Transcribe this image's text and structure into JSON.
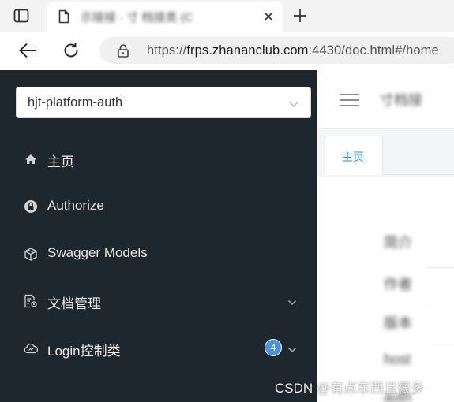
{
  "browser": {
    "tab_title": "示接接 · 寸 档接类 (C",
    "address": {
      "scheme": "https://",
      "host": "frps.zhananclub.com",
      "rest": ":4430/doc.html#/home"
    }
  },
  "sidebar": {
    "group_select": {
      "value": "hjt-platform-auth"
    },
    "items": [
      {
        "label": "主页",
        "icon": "home-icon"
      },
      {
        "label": "Authorize",
        "icon": "lock-icon"
      },
      {
        "label": "Swagger Models",
        "icon": "cube-icon"
      },
      {
        "label": "文档管理",
        "icon": "doc-settings-icon",
        "expandable": true
      },
      {
        "label": "Login控制类",
        "icon": "cloud-icon",
        "expandable": true,
        "badge": "4"
      }
    ]
  },
  "main": {
    "header_title": "寸档接",
    "tabs": [
      {
        "label": "主页",
        "active": true
      }
    ],
    "content_rows": [
      "简介",
      "作者",
      "版本",
      "host",
      "auth"
    ]
  },
  "watermark": "CSDN @有点东西且很多",
  "colors": {
    "sidebar_bg": "#1f272e",
    "accent": "#1890ff",
    "badge": "#4a90e2"
  }
}
